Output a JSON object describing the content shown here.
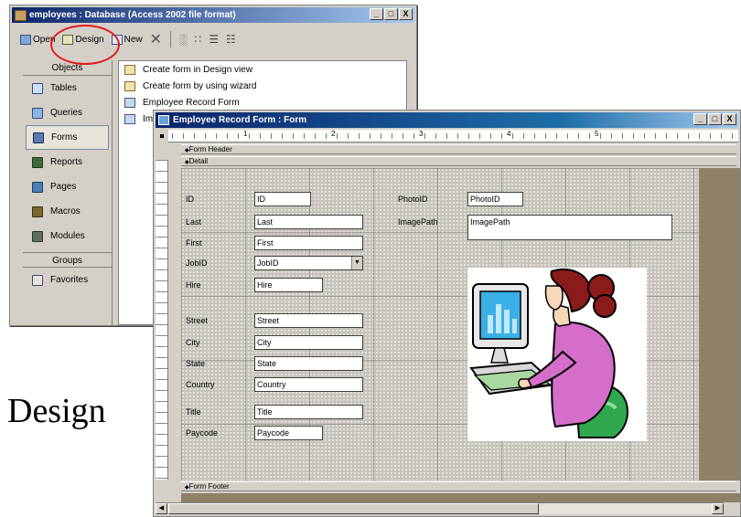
{
  "db_window": {
    "title": "employees : Database (Access 2002 file format)",
    "title_buttons": [
      "_",
      "□",
      "X"
    ],
    "toolbar": {
      "open_label": "Open",
      "design_label": "Design",
      "new_label": "New"
    },
    "objects_header": "Objects",
    "objects": [
      {
        "label": "Tables",
        "icon": "table-icon"
      },
      {
        "label": "Queries",
        "icon": "query-icon"
      },
      {
        "label": "Forms",
        "icon": "form-icon"
      },
      {
        "label": "Reports",
        "icon": "report-icon"
      },
      {
        "label": "Pages",
        "icon": "page-icon"
      },
      {
        "label": "Macros",
        "icon": "macro-icon"
      },
      {
        "label": "Modules",
        "icon": "module-icon"
      }
    ],
    "selected_object": "Forms",
    "groups_header": "Groups",
    "groups": [
      {
        "label": "Favorites",
        "icon": "favorites-icon"
      }
    ],
    "list": [
      "Create form in Design view",
      "Create form by using wizard",
      "Employee Record Form",
      "Im"
    ]
  },
  "form_window": {
    "title": "Employee Record Form : Form",
    "title_buttons": [
      "_",
      "□",
      "X"
    ],
    "ruler_numbers": [
      "1",
      "2",
      "3",
      "4",
      "5"
    ],
    "sections": {
      "header": "Form Header",
      "detail": "Detail",
      "footer": "Form Footer"
    },
    "fields": [
      {
        "label": "ID",
        "control": "ID"
      },
      {
        "label": "Last",
        "control": "Last"
      },
      {
        "label": "First",
        "control": "First"
      },
      {
        "label": "JobID",
        "control": "JobID"
      },
      {
        "label": "Hire",
        "control": "Hire"
      },
      {
        "label": "Street",
        "control": "Street"
      },
      {
        "label": "City",
        "control": "City"
      },
      {
        "label": "State",
        "control": "State"
      },
      {
        "label": "Country",
        "control": "Country"
      },
      {
        "label": "Title",
        "control": "Title"
      },
      {
        "label": "Paycode",
        "control": "Paycode"
      },
      {
        "label": "PhotoID",
        "control": "PhotoID"
      },
      {
        "label": "ImagePath",
        "control": "ImagePath"
      }
    ]
  },
  "caption": "Design",
  "colors": {
    "highlight_circle": "#e01c1c",
    "titlebar": "#0a246a",
    "detail_back": "#8e8168"
  }
}
